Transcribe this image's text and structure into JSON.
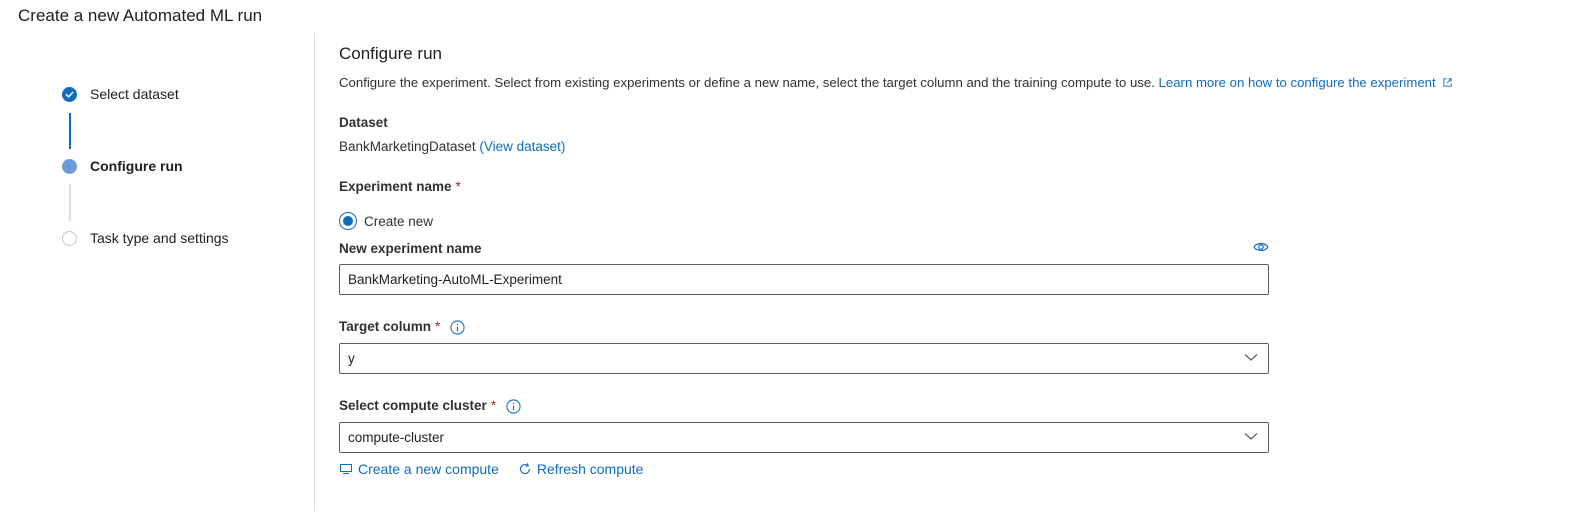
{
  "page": {
    "title": "Create a new Automated ML run"
  },
  "steps": [
    {
      "label": "Select dataset",
      "state": "completed"
    },
    {
      "label": "Configure run",
      "state": "current"
    },
    {
      "label": "Task type and settings",
      "state": "upcoming"
    }
  ],
  "main": {
    "title": "Configure run",
    "description": "Configure the experiment. Select from existing experiments or define a new name, select the target column and the training compute to use.",
    "learn_more": "Learn more on how to configure the experiment",
    "dataset": {
      "label": "Dataset",
      "value": "BankMarketingDataset",
      "view_link": "(View dataset)"
    },
    "experiment": {
      "label": "Experiment name",
      "required": "*",
      "radio_label": "Create new",
      "new_name_label": "New experiment name",
      "new_name_value": "BankMarketing-AutoML-Experiment"
    },
    "target": {
      "label": "Target column",
      "required": "*",
      "value": "y"
    },
    "compute": {
      "label": "Select compute cluster",
      "required": "*",
      "value": "compute-cluster",
      "create_link": "Create a new compute",
      "refresh_link": "Refresh compute"
    }
  },
  "colors": {
    "accent": "#0f6cbd",
    "required": "#a4262c"
  },
  "icons": [
    "checkmark-icon",
    "external-link-icon",
    "eye-icon",
    "info-icon",
    "chevron-down-icon",
    "compute-icon",
    "refresh-icon"
  ]
}
